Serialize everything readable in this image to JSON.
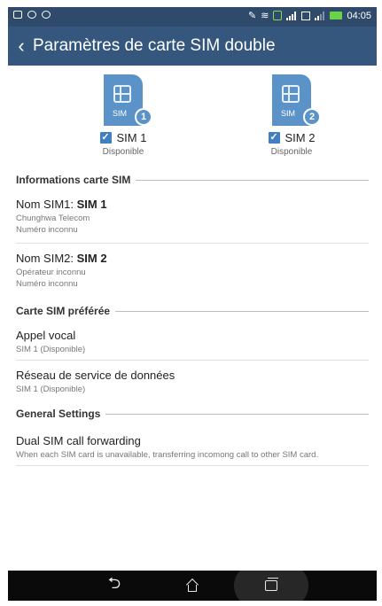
{
  "status_bar": {
    "time": "04:05",
    "battery_color": "#6bd34a"
  },
  "header": {
    "back_icon": "back-chevron-icon",
    "title": "Paramètres de carte SIM double"
  },
  "sims": [
    {
      "icon_text": "SIM",
      "badge": "1",
      "label": "SIM 1",
      "checked": true,
      "status": "Disponible"
    },
    {
      "icon_text": "SIM",
      "badge": "2",
      "label": "SIM 2",
      "checked": true,
      "status": "Disponible"
    }
  ],
  "sections": {
    "sim_info": {
      "header": "Informations carte SIM",
      "items": [
        {
          "name_prefix": "Nom SIM1: ",
          "name_value": "SIM 1",
          "line1": "Chunghwa Telecom",
          "line2": "Numéro inconnu"
        },
        {
          "name_prefix": "Nom SIM2: ",
          "name_value": "SIM 2",
          "line1": "Opérateur inconnu",
          "line2": "Numéro inconnu"
        }
      ]
    },
    "preferred": {
      "header": "Carte SIM préférée",
      "items": [
        {
          "title": "Appel vocal",
          "subtitle": "SIM 1 (Disponible)"
        },
        {
          "title": "Réseau de service de données",
          "subtitle": "SIM 1 (Disponible)"
        }
      ]
    },
    "general": {
      "header": "General Settings",
      "items": [
        {
          "title": "Dual SIM call forwarding",
          "subtitle": "When each SIM card is unavailable, transferring incomong call to other SIM card."
        }
      ]
    }
  },
  "colors": {
    "status_bar": "#2f4a6a",
    "title_bar": "#35577e",
    "sim_icon": "#5b93c9",
    "checkbox": "#3f7fc2",
    "nav_bar": "#0a0a0a"
  },
  "nav": {
    "back": "back-nav-icon",
    "home": "home-nav-icon",
    "recent": "recent-apps-icon"
  }
}
